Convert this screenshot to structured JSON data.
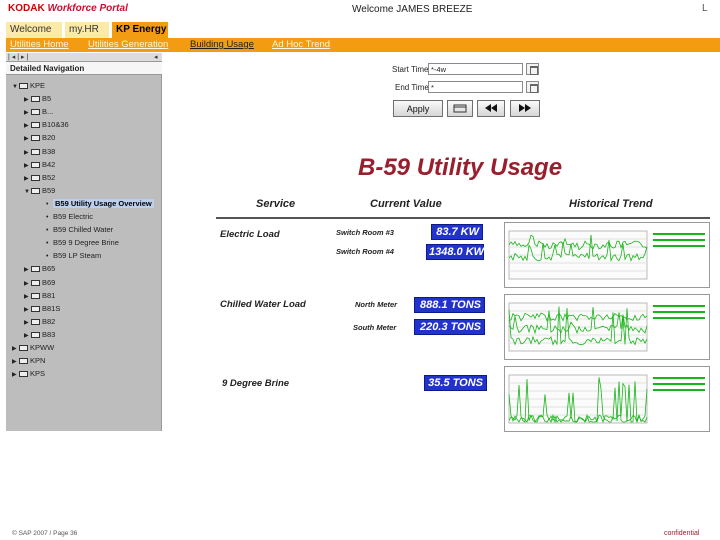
{
  "header": {
    "brand": "KODAK",
    "portal": "Workforce Portal",
    "welcome": "Welcome JAMES BREEZE",
    "corner": "L"
  },
  "tabs": [
    {
      "label": "Welcome"
    },
    {
      "label": "my.HR"
    },
    {
      "label": "KP Energy"
    }
  ],
  "subnav": [
    {
      "label": "Utilities Home"
    },
    {
      "label": "Utilities Generation"
    },
    {
      "label": "Building Usage"
    },
    {
      "label": "Ad Hoc Trend"
    }
  ],
  "leftnav": {
    "toolbar": "| ◂ | ▸ |",
    "collapse": "◂",
    "title": "Detailed Navigation",
    "items": [
      {
        "label": "KPE"
      },
      {
        "label": "B5"
      },
      {
        "label": "B..."
      },
      {
        "label": "B10&36"
      },
      {
        "label": "B20"
      },
      {
        "label": "B38"
      },
      {
        "label": "B42"
      },
      {
        "label": "B52"
      },
      {
        "label": "B59"
      },
      {
        "label": "B59 Utility Usage Overview"
      },
      {
        "label": "B59 Electric"
      },
      {
        "label": "B59 Chilled Water"
      },
      {
        "label": "B59 9 Degree Brine"
      },
      {
        "label": "B59 LP Steam"
      },
      {
        "label": "B65"
      },
      {
        "label": "B69"
      },
      {
        "label": "B81"
      },
      {
        "label": "B81S"
      },
      {
        "label": "B82"
      },
      {
        "label": "B83"
      },
      {
        "label": "KPWW"
      },
      {
        "label": "KPN"
      },
      {
        "label": "KPS"
      }
    ]
  },
  "controls": {
    "start_label": "Start Time:",
    "start_value": "*-4w",
    "end_label": "End Time:",
    "end_value": "*",
    "apply": "Apply"
  },
  "report": {
    "title": "B-59 Utility Usage",
    "headers": {
      "service": "Service",
      "current": "Current Value",
      "trend": "Historical Trend"
    },
    "rows": [
      {
        "service": "Electric Load",
        "meters": [
          {
            "name": "Switch Room #3",
            "value": "83.7 KW"
          },
          {
            "name": "Switch Room #4",
            "value": "1348.0 KW"
          }
        ]
      },
      {
        "service": "Chilled Water Load",
        "meters": [
          {
            "name": "North Meter",
            "value": "888.1 TONS"
          },
          {
            "name": "South Meter",
            "value": "220.3 TONS"
          }
        ]
      },
      {
        "service": "9 Degree Brine",
        "meters": [
          {
            "name": "",
            "value": "35.5 TONS"
          }
        ]
      }
    ]
  },
  "colors": {
    "tab_active": "#f29c13",
    "tab_inactive": "#fde9a8",
    "subnav_bar": "#f39c12",
    "title_red": "#9a1f2e",
    "value_blue": "#2233cc",
    "trend_green": "#19b419"
  },
  "footer": {
    "copyright": "© SAP 2007 / Page 36",
    "confidential": "confidential"
  }
}
